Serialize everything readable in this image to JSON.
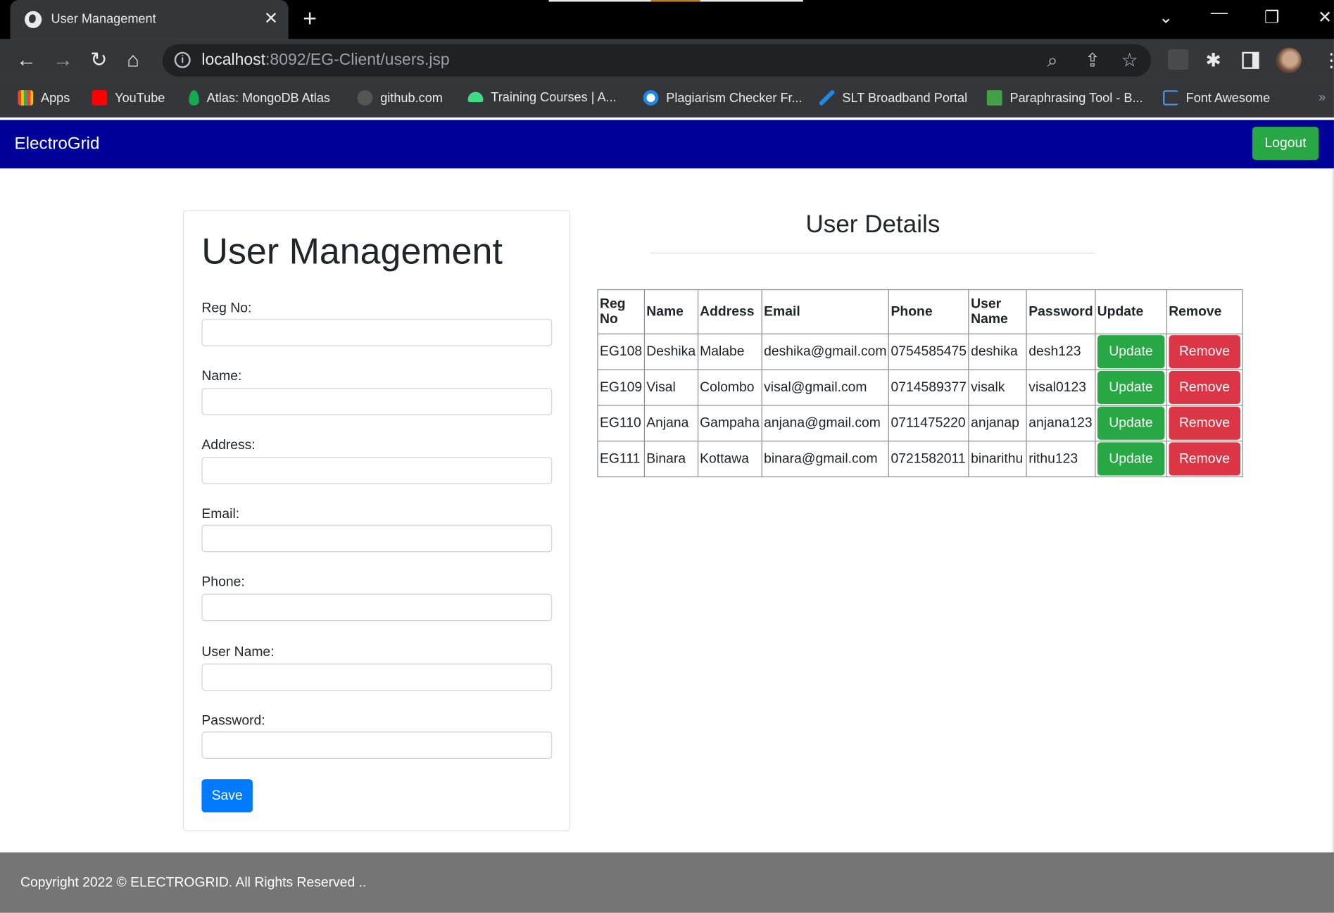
{
  "browser": {
    "tab_title": "User Management",
    "url_host": "localhost",
    "url_rest": ":8092/EG-Client/users.jsp",
    "bookmarks": [
      {
        "label": "Apps",
        "icon": "apps-grid-icon",
        "color": "#ea4335"
      },
      {
        "label": "YouTube",
        "icon": "youtube-icon",
        "color": "#ff0000"
      },
      {
        "label": "Atlas: MongoDB Atlas",
        "icon": "mongodb-leaf-icon",
        "color": "#13aa52"
      },
      {
        "label": "github.com",
        "icon": "github-icon",
        "color": "#555555"
      },
      {
        "label": "Training Courses  |  A...",
        "icon": "android-icon",
        "color": "#3ddc84"
      },
      {
        "label": "Plagiarism Checker Fr...",
        "icon": "plagiarism-checker-icon",
        "color": "#1e88e5"
      },
      {
        "label": "SLT Broadband Portal",
        "icon": "slt-icon",
        "color": "#1e88e5"
      },
      {
        "label": "Paraphrasing Tool - B...",
        "icon": "paraphrasing-tool-icon",
        "color": "#43a047"
      },
      {
        "label": "Font Awesome",
        "icon": "font-awesome-flag-icon",
        "color": "#528dd7"
      }
    ]
  },
  "site": {
    "brand": "ElectroGrid",
    "logout_label": "Logout",
    "nav_color": "#000099"
  },
  "form": {
    "title": "User Management",
    "fields": [
      {
        "label": "Reg No:",
        "value": ""
      },
      {
        "label": "Name:",
        "value": ""
      },
      {
        "label": "Address:",
        "value": ""
      },
      {
        "label": "Email:",
        "value": ""
      },
      {
        "label": "Phone:",
        "value": ""
      },
      {
        "label": "User Name:",
        "value": ""
      },
      {
        "label": "Password:",
        "value": ""
      }
    ],
    "save_label": "Save"
  },
  "details": {
    "title": "User Details",
    "columns": [
      "Reg No",
      "Name",
      "Address",
      "Email",
      "Phone",
      "User Name",
      "Password",
      "Update",
      "Remove"
    ],
    "rows": [
      {
        "reg": "EG108",
        "name": "Deshika",
        "address": "Malabe",
        "email": "deshika@gmail.com",
        "phone": "0754585475",
        "username": "deshika",
        "password": "desh123"
      },
      {
        "reg": "EG109",
        "name": "Visal",
        "address": "Colombo",
        "email": "visal@gmail.com",
        "phone": "0714589377",
        "username": "visalk",
        "password": "visal0123"
      },
      {
        "reg": "EG110",
        "name": "Anjana",
        "address": "Gampaha",
        "email": "anjana@gmail.com",
        "phone": "0711475220",
        "username": "anjanap",
        "password": "anjana123"
      },
      {
        "reg": "EG111",
        "name": "Binara",
        "address": "Kottawa",
        "email": "binara@gmail.com",
        "phone": "0721582011",
        "username": "binarithu",
        "password": "rithu123"
      }
    ],
    "update_label": "Update",
    "remove_label": "Remove"
  },
  "footer": {
    "text": "Copyright 2022 © ELECTROGRID. All Rights Reserved .."
  }
}
